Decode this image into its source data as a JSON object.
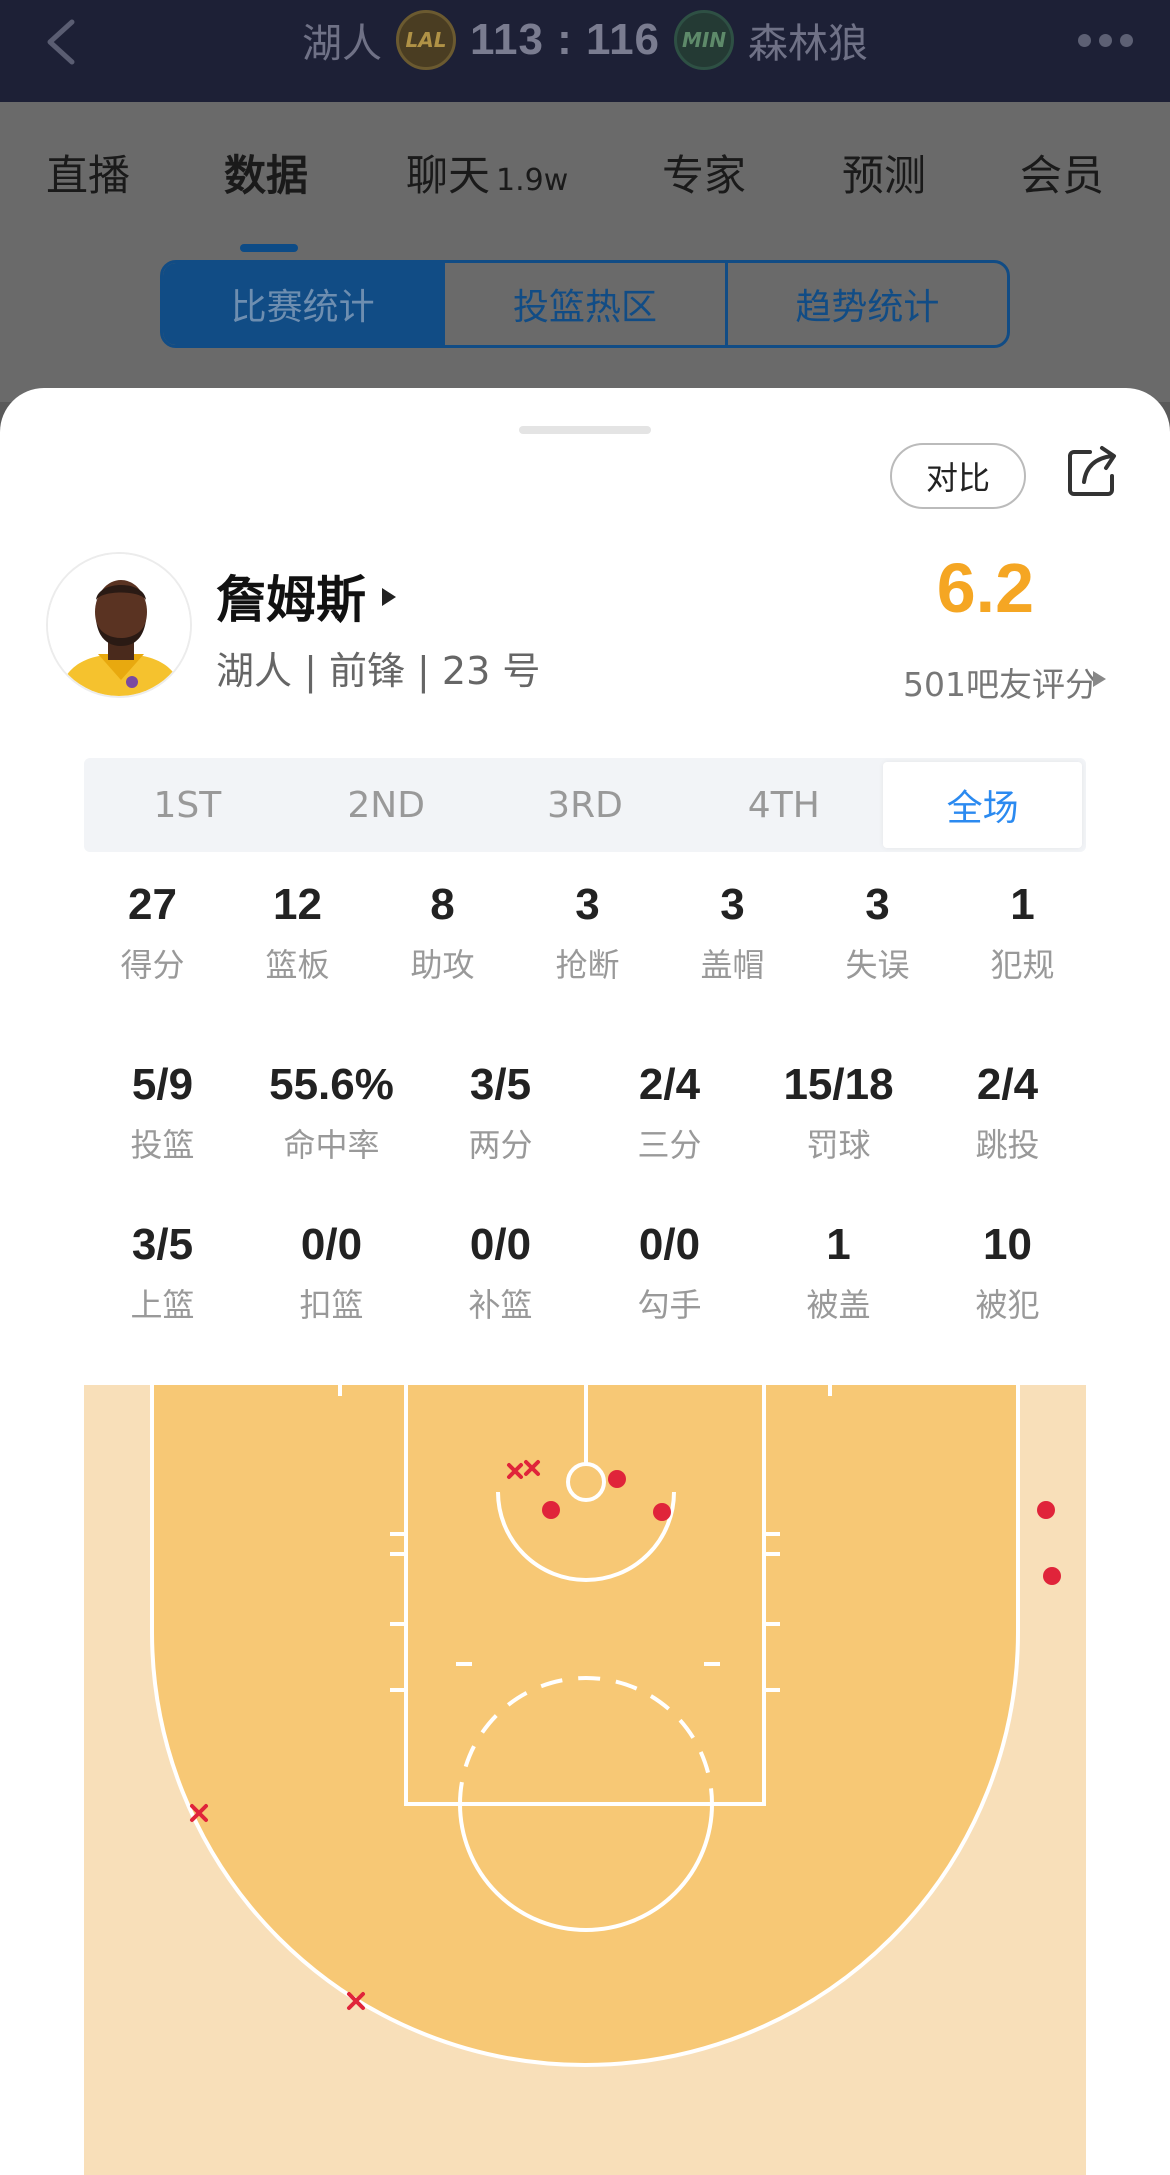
{
  "topbar": {
    "home_team": "湖人",
    "home_logo": "LAL",
    "score": "113 : 116",
    "away_logo": "MIN",
    "away_team": "森林狼"
  },
  "main_tabs": [
    {
      "label": "直播",
      "sub": ""
    },
    {
      "label": "数据",
      "sub": ""
    },
    {
      "label": "聊天",
      "sub": "1.9w"
    },
    {
      "label": "专家",
      "sub": ""
    },
    {
      "label": "预测",
      "sub": ""
    },
    {
      "label": "会员",
      "sub": ""
    }
  ],
  "segment_tabs": [
    "比赛统计",
    "投篮热区",
    "趋势统计"
  ],
  "sheet": {
    "compare_label": "对比",
    "player": {
      "name": "詹姆斯",
      "info": "湖人 | 前锋 | 23 号"
    },
    "rating": {
      "score": "6.2",
      "votes": "501吧友评分"
    },
    "quarter_tabs": [
      "1ST",
      "2ND",
      "3RD",
      "4TH",
      "全场"
    ],
    "active_quarter": "全场",
    "stats_row1": [
      {
        "value": "27",
        "label": "得分"
      },
      {
        "value": "12",
        "label": "篮板"
      },
      {
        "value": "8",
        "label": "助攻"
      },
      {
        "value": "3",
        "label": "抢断"
      },
      {
        "value": "3",
        "label": "盖帽"
      },
      {
        "value": "3",
        "label": "失误"
      },
      {
        "value": "1",
        "label": "犯规"
      }
    ],
    "stats_row2": [
      {
        "value": "5/9",
        "label": "投篮"
      },
      {
        "value": "55.6%",
        "label": "命中率"
      },
      {
        "value": "3/5",
        "label": "两分"
      },
      {
        "value": "2/4",
        "label": "三分"
      },
      {
        "value": "15/18",
        "label": "罚球"
      },
      {
        "value": "2/4",
        "label": "跳投"
      }
    ],
    "stats_row3": [
      {
        "value": "3/5",
        "label": "上篮"
      },
      {
        "value": "0/0",
        "label": "扣篮"
      },
      {
        "value": "0/0",
        "label": "补篮"
      },
      {
        "value": "0/0",
        "label": "勾手"
      },
      {
        "value": "1",
        "label": "被盖"
      },
      {
        "value": "10",
        "label": "被犯"
      }
    ]
  },
  "colors": {
    "court_inner": "#f7c875",
    "court_outer": "#f8dfb9",
    "made_shot": "#e0243a",
    "missed_shot": "#e0243a",
    "rating": "#f5a623",
    "accent": "#2b8af0"
  }
}
